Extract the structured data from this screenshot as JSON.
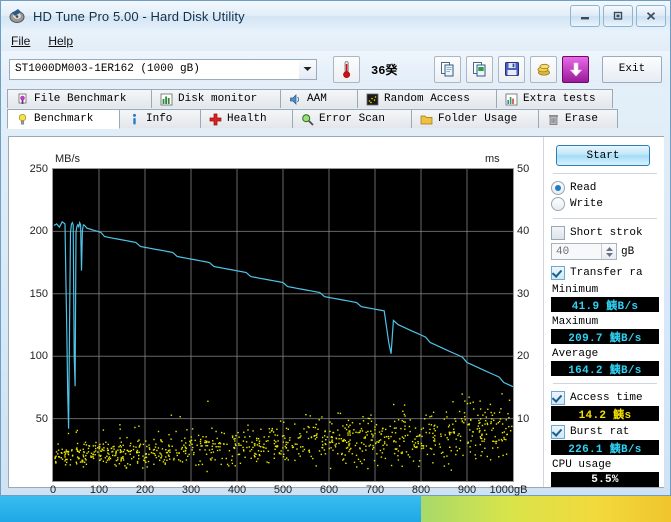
{
  "window": {
    "title": "HD Tune Pro 5.00 - Hard Disk Utility",
    "app_icon": "hdtune-icon",
    "buttons": {
      "minimize": "minimize-icon",
      "maximize": "maximize-icon",
      "close": "close-icon"
    }
  },
  "menu": {
    "items": [
      "File",
      "Help"
    ]
  },
  "toolbar": {
    "drive": "ST1000DM003-1ER162  (1000 gB)",
    "drive_icon": "chevron-down-icon",
    "temperature_icon": "thermometer-icon",
    "temperature": "36",
    "temperature_unit": "癸",
    "buttons": [
      {
        "name": "copy-button",
        "icon": "copy-icon"
      },
      {
        "name": "copy-image-button",
        "icon": "copy-image-icon"
      },
      {
        "name": "save-button",
        "icon": "floppy-disk-icon"
      },
      {
        "name": "options-button",
        "icon": "gold-coins-icon"
      },
      {
        "name": "download-button",
        "icon": "down-arrow-icon"
      }
    ],
    "exit_label": "Exit"
  },
  "tabs": {
    "row_top": [
      {
        "label": "File Benchmark",
        "icon": "file-benchmark-icon",
        "active": false
      },
      {
        "label": "Disk monitor",
        "icon": "disk-monitor-icon",
        "active": false
      },
      {
        "label": "AAM",
        "icon": "speaker-icon",
        "active": false
      },
      {
        "label": "Random Access",
        "icon": "random-access-icon",
        "active": false
      },
      {
        "label": "Extra tests",
        "icon": "extra-tests-icon",
        "active": false
      }
    ],
    "row_bottom": [
      {
        "label": "Benchmark",
        "icon": "lightbulb-icon",
        "active": true
      },
      {
        "label": "Info",
        "icon": "info-icon",
        "active": false
      },
      {
        "label": "Health",
        "icon": "health-cross-icon",
        "active": false
      },
      {
        "label": "Error Scan",
        "icon": "magnifier-icon",
        "active": false
      },
      {
        "label": "Folder Usage",
        "icon": "folder-icon",
        "active": false
      },
      {
        "label": "Erase",
        "icon": "trash-icon",
        "active": false
      }
    ]
  },
  "sidebar": {
    "start_label": "Start",
    "mode": {
      "read_label": "Read",
      "write_label": "Write",
      "selected": "Read"
    },
    "short_stroke": {
      "label": "Short strok",
      "checked": false,
      "value": "40",
      "unit": "gB"
    },
    "transfer_rate": {
      "label": "Transfer ra",
      "checked": true
    },
    "stats": [
      {
        "label": "Minimum",
        "value": "41.9 鮧B/s",
        "color": "cyan"
      },
      {
        "label": "Maximum",
        "value": "209.7 鮧B/s",
        "color": "cyan"
      },
      {
        "label": "Average",
        "value": "164.2 鮧B/s",
        "color": "cyan"
      }
    ],
    "access_time": {
      "label": "Access time",
      "checked": true,
      "value": "14.2 鮧s",
      "color": "yellow"
    },
    "burst_rate": {
      "label": "Burst rat",
      "checked": true,
      "value": "226.1 鮧B/s",
      "color": "cyan"
    },
    "cpu_usage": {
      "label": "CPU usage",
      "value": "5.5%",
      "color": "white"
    }
  },
  "chart_data": {
    "type": "line",
    "title": "",
    "xlabel": "gB",
    "ylabel": "MB/s",
    "y2label": "ms",
    "xlim": [
      0,
      1000
    ],
    "ylim": [
      0,
      250
    ],
    "y2lim": [
      0,
      50
    ],
    "grid": true,
    "xticks": [
      0,
      100,
      200,
      300,
      400,
      500,
      600,
      700,
      800,
      900,
      1000
    ],
    "xtick_labels": [
      "0",
      "100",
      "200",
      "300",
      "400",
      "500",
      "600",
      "700",
      "800",
      "900",
      "1000"
    ],
    "x_unit_suffix": "gB",
    "yticks": [
      50,
      100,
      150,
      200,
      250
    ],
    "ytick_labels": [
      "50",
      "100",
      "150",
      "200",
      "250"
    ],
    "y2ticks": [
      10,
      20,
      30,
      40,
      50
    ],
    "y2tick_labels": [
      "10",
      "20",
      "30",
      "40",
      "50"
    ],
    "colors": {
      "transfer_rate": "#4fc3e8",
      "access_time": "#e8e800",
      "plot_bg": "#000000",
      "grid": "#8a8a8a"
    },
    "series": [
      {
        "name": "Transfer rate",
        "type": "line",
        "color": "#4fc3e8",
        "axis": "left",
        "units": "MB/s",
        "x": [
          2,
          8,
          14,
          20,
          26,
          28,
          30,
          32,
          34,
          36,
          38,
          40,
          42,
          44,
          46,
          48,
          50,
          52,
          54,
          56,
          58,
          60,
          62,
          64,
          66,
          68,
          70,
          74,
          80,
          86,
          92,
          98,
          104,
          112,
          120,
          130,
          140,
          150,
          160,
          170,
          180,
          190,
          200,
          210,
          220,
          230,
          240,
          250,
          260,
          270,
          280,
          290,
          300,
          310,
          320,
          330,
          340,
          350,
          360,
          370,
          380,
          390,
          400,
          410,
          420,
          430,
          440,
          450,
          460,
          470,
          480,
          490,
          500,
          510,
          520,
          530,
          540,
          550,
          560,
          570,
          580,
          590,
          600,
          610,
          620,
          630,
          640,
          650,
          660,
          670,
          680,
          690,
          700,
          710,
          720,
          730,
          735,
          740,
          745,
          750,
          760,
          770,
          780,
          790,
          800,
          810,
          820,
          830,
          840,
          850,
          860,
          870,
          880,
          890,
          900,
          910,
          920,
          930,
          940,
          950,
          960,
          970,
          980,
          990,
          1000
        ],
        "y": [
          206,
          207,
          204,
          208,
          206,
          160,
          120,
          70,
          41.9,
          130,
          200,
          206,
          207,
          205,
          100,
          75,
          198,
          205,
          206,
          204,
          207,
          205,
          168,
          200,
          204,
          206,
          205,
          203,
          202,
          201,
          200,
          199,
          198,
          197,
          196,
          195,
          194,
          193,
          192,
          191,
          190,
          189,
          188,
          187,
          186,
          185,
          184,
          183,
          182,
          181,
          180,
          179,
          178,
          177,
          176,
          175,
          174,
          173,
          172,
          171,
          170,
          169,
          168,
          167,
          166,
          165,
          164,
          163,
          162,
          161,
          160,
          159,
          158,
          157,
          156,
          155,
          154,
          153,
          152,
          151,
          150,
          149,
          148,
          147,
          146,
          145,
          144,
          143,
          142,
          141,
          140,
          139,
          138,
          137,
          136,
          110,
          101,
          130,
          128,
          126,
          124,
          122,
          120,
          118,
          116,
          114,
          112,
          110,
          108,
          106,
          104,
          102,
          100,
          98,
          96,
          94,
          92,
          90,
          88,
          86,
          84,
          82,
          80,
          78,
          76,
          74
        ]
      },
      {
        "name": "Access time",
        "type": "scatter",
        "color": "#e8e800",
        "axis": "right",
        "units": "ms",
        "mean_ms": 14.2,
        "description": "Scattered yellow access-time samples spread from about 3 ms to 14 ms across the full 0-1000 gB span, denser toward the low end and drifting slightly higher with capacity."
      }
    ]
  }
}
